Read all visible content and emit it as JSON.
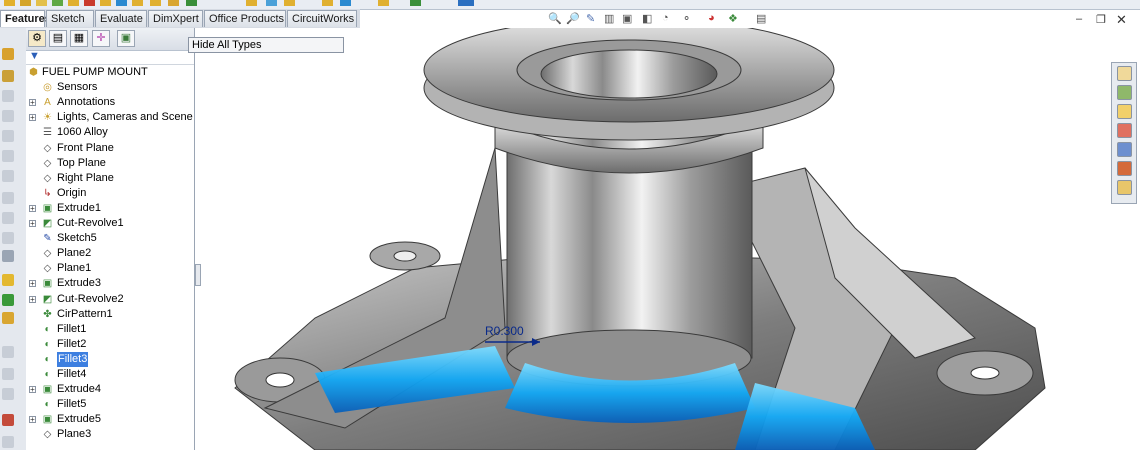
{
  "command_tabs": [
    {
      "label": "Features",
      "active": true
    },
    {
      "label": "Sketch",
      "active": false
    },
    {
      "label": "Evaluate",
      "active": false
    },
    {
      "label": "DimXpert",
      "active": false
    },
    {
      "label": "Office Products",
      "active": false
    },
    {
      "label": "CircuitWorks",
      "active": false
    }
  ],
  "popup": {
    "label": "Hide All Types"
  },
  "tree": {
    "root": "FUEL PUMP MOUNT",
    "items": [
      {
        "label": "Sensors",
        "icon": "sensors-icon",
        "expand": false
      },
      {
        "label": "Annotations",
        "icon": "annotations-icon",
        "expand": true
      },
      {
        "label": "Lights, Cameras and Scene",
        "icon": "lights-icon",
        "expand": true
      },
      {
        "label": "1060 Alloy",
        "icon": "material-icon",
        "expand": false
      },
      {
        "label": "Front Plane",
        "icon": "plane-icon",
        "expand": false
      },
      {
        "label": "Top Plane",
        "icon": "plane-icon",
        "expand": false
      },
      {
        "label": "Right Plane",
        "icon": "plane-icon",
        "expand": false
      },
      {
        "label": "Origin",
        "icon": "origin-icon",
        "expand": false
      },
      {
        "label": "Extrude1",
        "icon": "extrude-icon",
        "expand": true
      },
      {
        "label": "Cut-Revolve1",
        "icon": "revolve-icon",
        "expand": true
      },
      {
        "label": "Sketch5",
        "icon": "sketch-icon",
        "expand": false
      },
      {
        "label": "Plane2",
        "icon": "plane-icon",
        "expand": false
      },
      {
        "label": "Plane1",
        "icon": "plane-icon",
        "expand": false
      },
      {
        "label": "Extrude3",
        "icon": "extrude-icon",
        "expand": true
      },
      {
        "label": "Cut-Revolve2",
        "icon": "revolve-icon",
        "expand": true
      },
      {
        "label": "CirPattern1",
        "icon": "pattern-icon",
        "expand": false
      },
      {
        "label": "Fillet1",
        "icon": "fillet-icon",
        "expand": false
      },
      {
        "label": "Fillet2",
        "icon": "fillet-icon",
        "expand": false
      },
      {
        "label": "Fillet3",
        "icon": "fillet-icon",
        "expand": false,
        "selected": true
      },
      {
        "label": "Fillet4",
        "icon": "fillet-icon",
        "expand": false
      },
      {
        "label": "Extrude4",
        "icon": "extrude-icon",
        "expand": true
      },
      {
        "label": "Fillet5",
        "icon": "fillet-icon",
        "expand": false
      },
      {
        "label": "Extrude5",
        "icon": "extrude-icon",
        "expand": true
      },
      {
        "label": "Plane3",
        "icon": "plane-icon",
        "expand": false
      }
    ]
  },
  "dimension": {
    "label": "R0.300"
  },
  "colors": {
    "highlight": "#18b4ff",
    "selection": "#3d7fe0"
  }
}
